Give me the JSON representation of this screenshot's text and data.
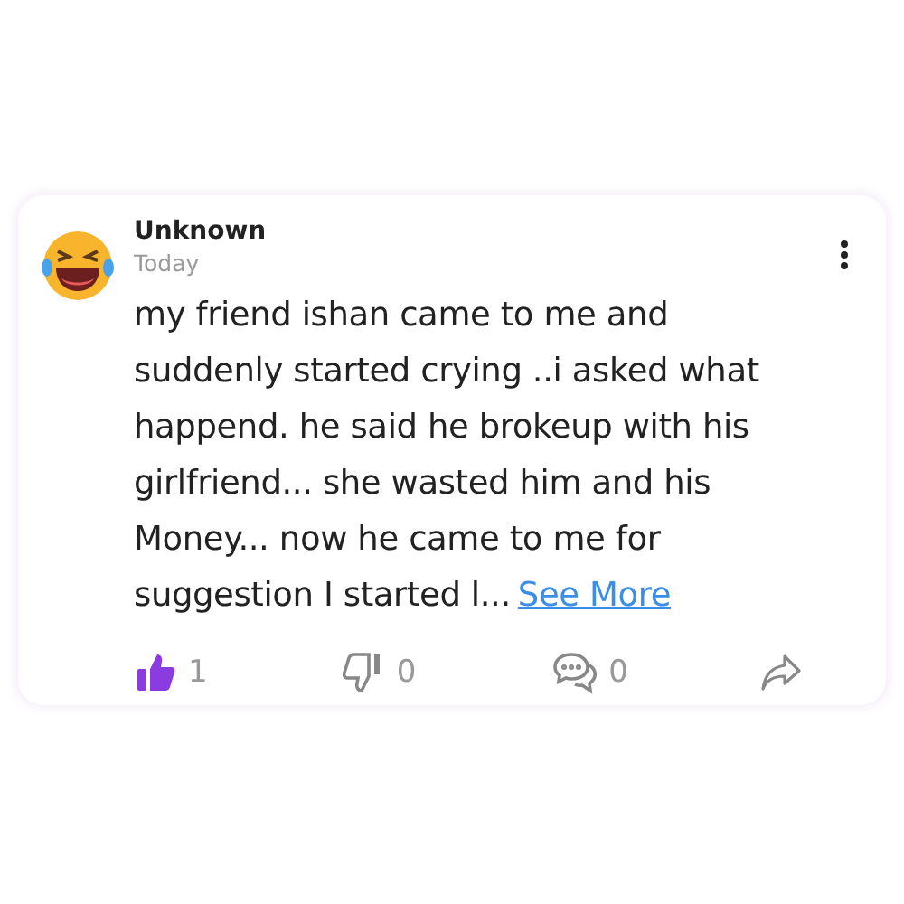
{
  "post": {
    "author": "Unknown",
    "time": "Today",
    "body": "my friend ishan came to me and suddenly started crying ..i asked what happend. he said he brokeup with his girlfriend... she wasted him and his Money... now he came to me for suggestion I started l...",
    "see_more": "See More",
    "actions": [
      {
        "kind": "like",
        "count": "1",
        "selected": true
      },
      {
        "kind": "dislike",
        "count": "0",
        "selected": false
      },
      {
        "kind": "comment",
        "count": "0"
      },
      {
        "kind": "share"
      }
    ]
  }
}
